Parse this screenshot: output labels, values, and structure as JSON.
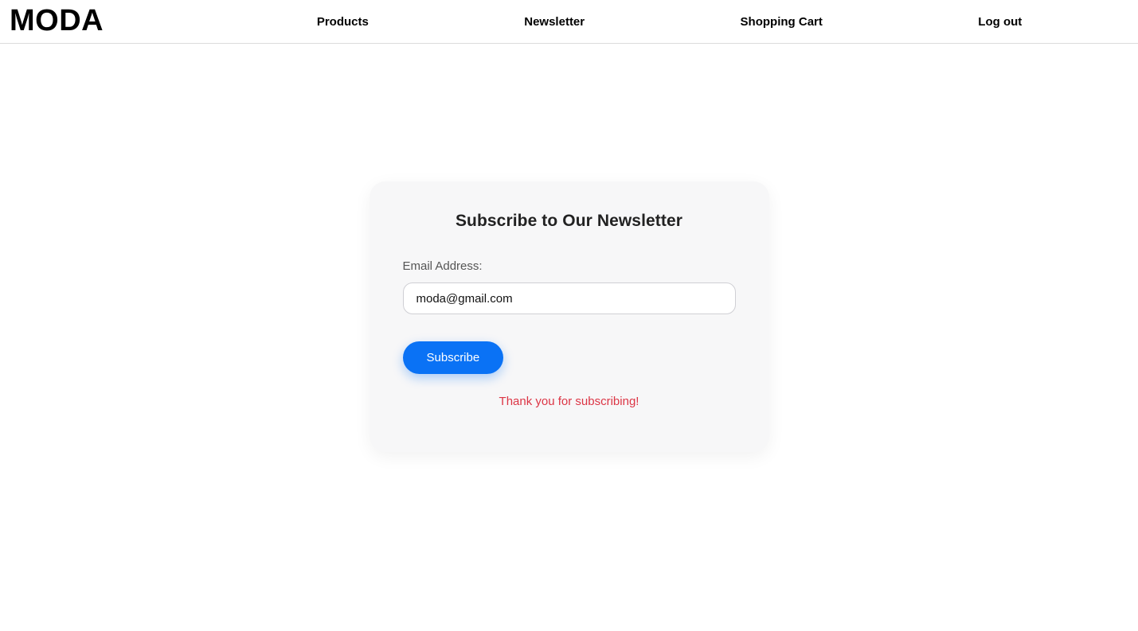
{
  "header": {
    "brand": "MODA",
    "nav": [
      {
        "label": "Products",
        "name": "nav-link-products"
      },
      {
        "label": "Newsletter",
        "name": "nav-link-newsletter"
      },
      {
        "label": "Shopping Cart",
        "name": "nav-link-shopping-cart"
      },
      {
        "label": "Log out",
        "name": "nav-link-log-out"
      }
    ]
  },
  "newsletter": {
    "title": "Subscribe to Our Newsletter",
    "email_label": "Email Address:",
    "email_value": "moda@gmail.com",
    "email_placeholder": "",
    "submit_label": "Subscribe",
    "status_message": "Thank you for subscribing!"
  },
  "colors": {
    "page_background": "#ffffff",
    "card_background": "#f7f7f8",
    "accent_blue": "#0a72f5",
    "status_red": "#dc3545",
    "title_text": "#222222",
    "label_text": "#555555",
    "header_border": "#dcdcdc"
  }
}
